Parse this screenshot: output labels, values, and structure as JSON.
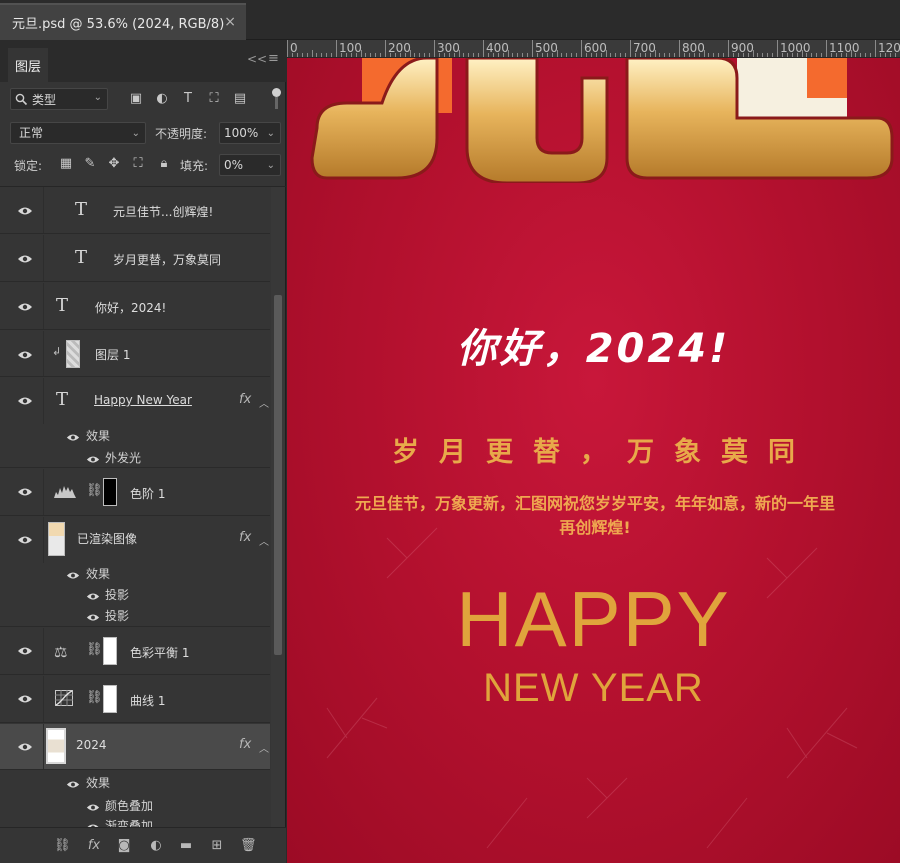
{
  "document_tab": {
    "title": "元旦.psd @ 53.6% (2024, RGB/8)",
    "close": "×"
  },
  "layers_panel": {
    "tab": "图层",
    "collapse": "<<",
    "menu": "≡",
    "filter_kind": "类型",
    "blend_mode": "正常",
    "opacity_label": "不透明度:",
    "opacity_value": "100%",
    "lock_label": "锁定:",
    "fill_label": "填充:",
    "fill_value": "0%",
    "layers": [
      {
        "name": "元旦佳节...创辉煌!",
        "kind": "text"
      },
      {
        "name": "岁月更替，万象莫同",
        "kind": "text"
      },
      {
        "name": "你好，2024!",
        "kind": "text"
      },
      {
        "name": "图层 1",
        "kind": "pixel"
      },
      {
        "name": "Happy  New Year",
        "kind": "text",
        "fx": "fx",
        "effects_label": "效果",
        "effects": [
          "外发光"
        ]
      },
      {
        "name": "色阶 1",
        "kind": "adjustment"
      },
      {
        "name": "已渲染图像",
        "kind": "smart",
        "fx": "fx",
        "effects_label": "效果",
        "effects": [
          "投影",
          "投影"
        ]
      },
      {
        "name": "色彩平衡 1",
        "kind": "adjustment"
      },
      {
        "name": "曲线 1",
        "kind": "adjustment"
      },
      {
        "name": "2024",
        "kind": "smart",
        "fx": "fx",
        "effects_label": "效果",
        "effects": [
          "颜色叠加",
          "渐变叠加"
        ]
      }
    ],
    "footer_fx": "fx"
  },
  "ruler": {
    "labels": [
      "0",
      "100",
      "200",
      "300",
      "400",
      "500",
      "600",
      "700",
      "800",
      "900",
      "1000",
      "1100",
      "120"
    ]
  },
  "poster": {
    "greeting": "你好，2024!",
    "subtitle": "岁月更替，万象莫同",
    "body": "元旦佳节，万象更新，汇图网祝您岁岁平安，年年如意，新的一年里再创辉煌!",
    "happy": "HAPPY",
    "new_year": "NEW YEAR"
  },
  "colors": {
    "poster_red": "#b5112f",
    "gold": "#e0a43c",
    "panel_bg": "#353535"
  }
}
